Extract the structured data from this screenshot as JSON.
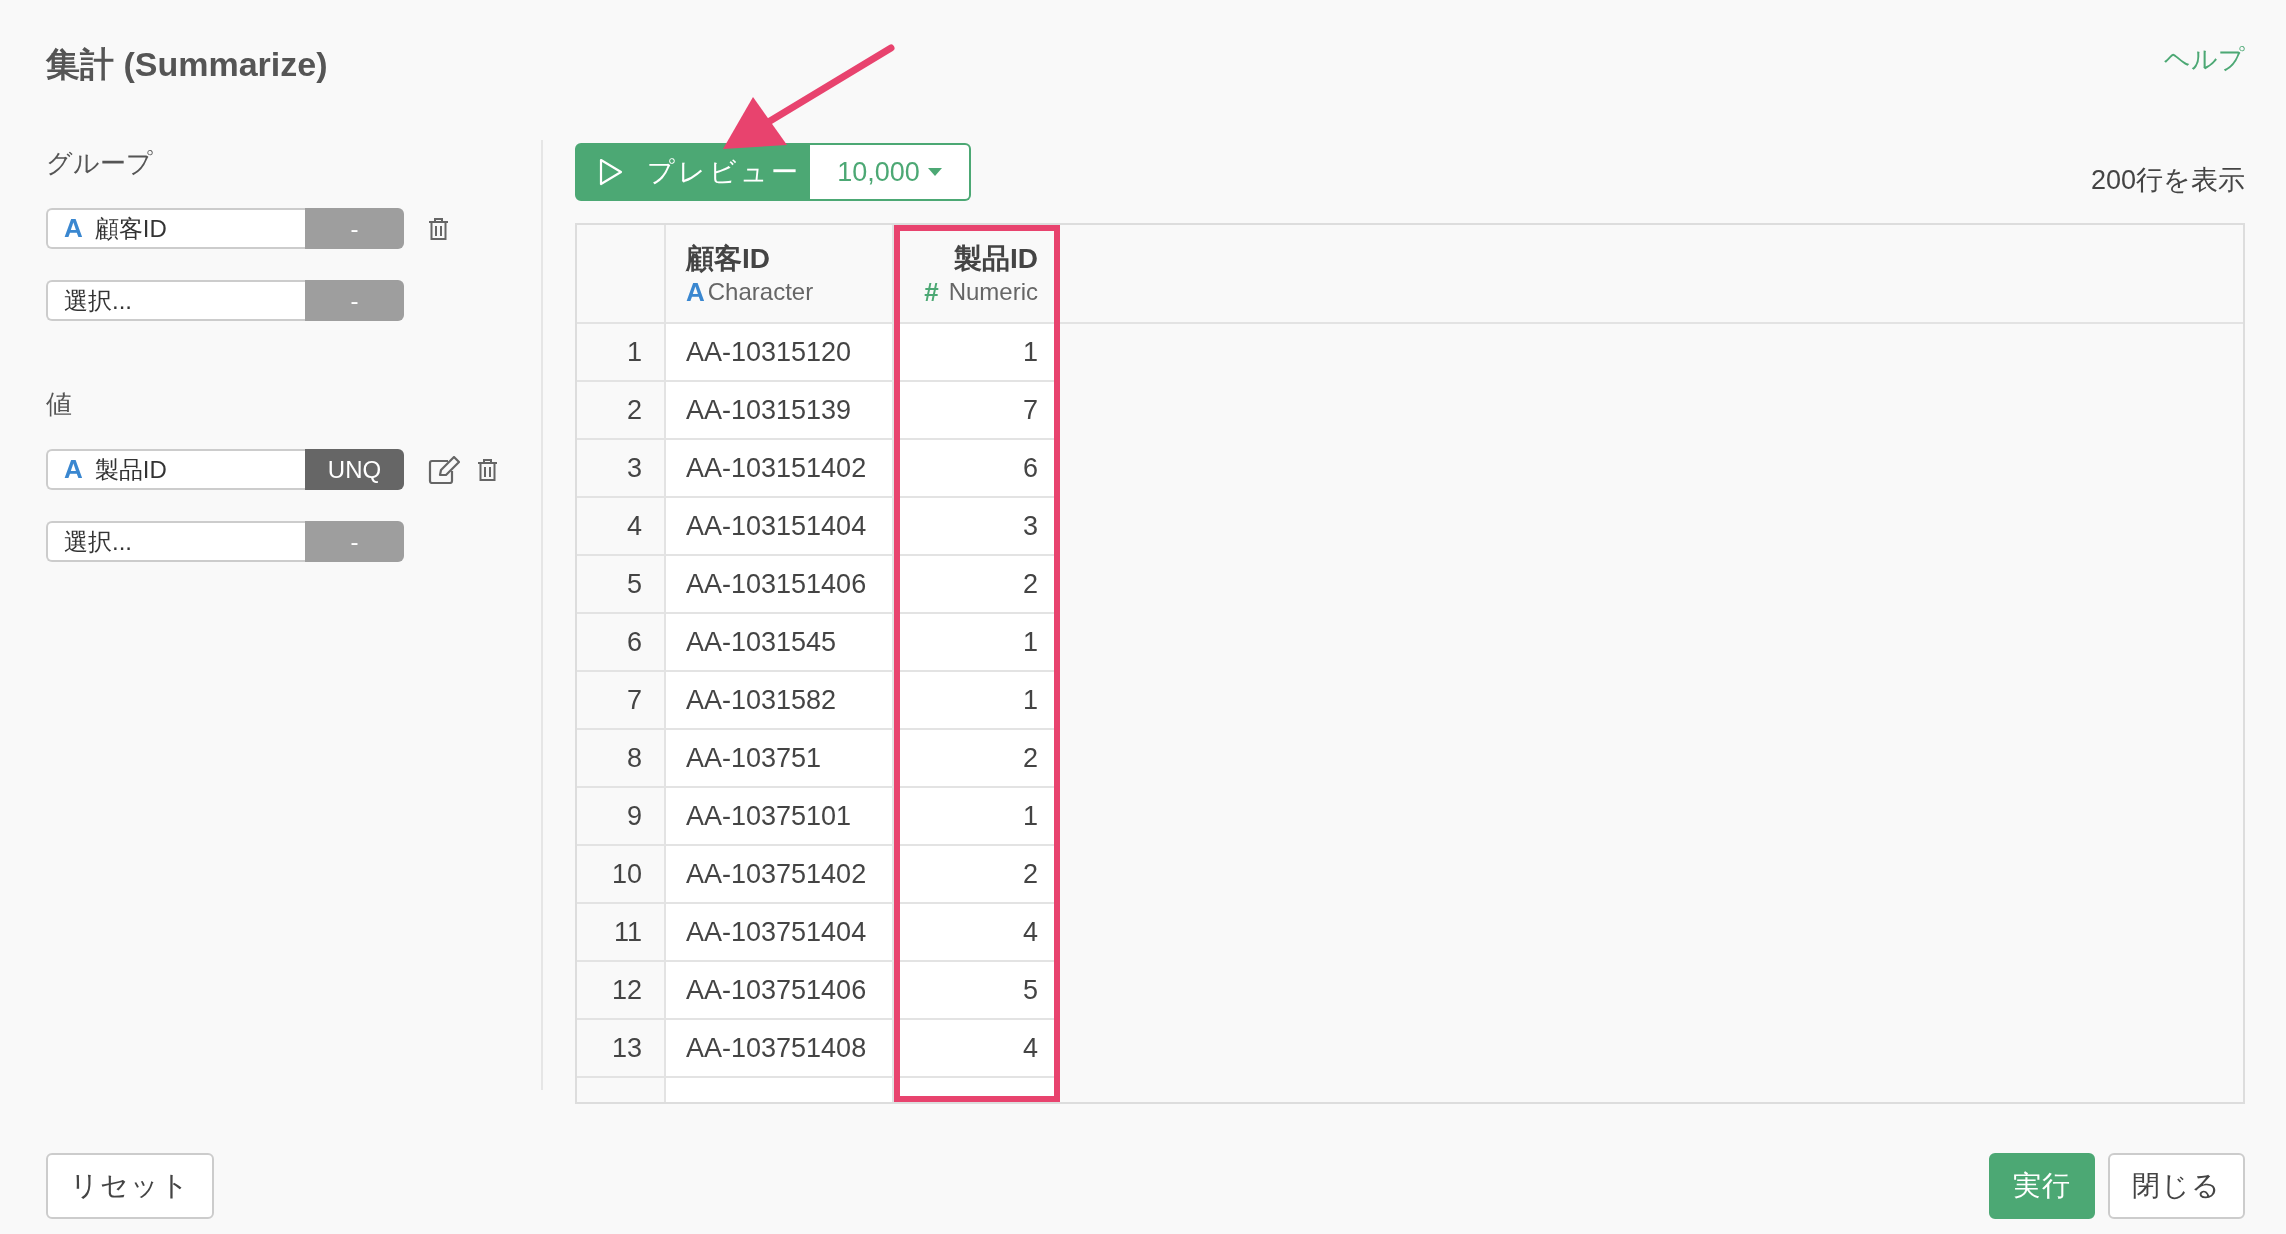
{
  "title": "集計 (Summarize)",
  "help_link": "ヘルプ",
  "sections": [
    {
      "label": "グループ",
      "rows": [
        {
          "kind": "character",
          "type_icon": "A",
          "value": "顧客ID",
          "function": "-",
          "function_set": false,
          "editable": false,
          "removable": true
        },
        {
          "placeholder": "選択...",
          "function": "-",
          "function_set": false,
          "editable": false,
          "removable": false
        }
      ]
    },
    {
      "label": "値",
      "rows": [
        {
          "kind": "character",
          "type_icon": "A",
          "value": "製品ID",
          "function": "UNQ",
          "function_set": true,
          "editable": true,
          "removable": true
        },
        {
          "placeholder": "選択...",
          "function": "-",
          "function_set": false,
          "editable": false,
          "removable": false
        }
      ]
    }
  ],
  "preview": {
    "label": "プレビュー",
    "arrow_pointer": true,
    "row_limit": "10,000"
  },
  "row_count": "200行を表示",
  "table": {
    "columns": [
      {
        "name": "顧客ID",
        "kind": "character",
        "type_icon": "A",
        "type": "Character",
        "highlighted": false
      },
      {
        "name": "製品ID",
        "kind": "numeric",
        "type_icon": "#",
        "type": "Numeric",
        "highlighted": true
      }
    ],
    "rows": [
      {
        "number": "1",
        "cells": [
          "AA-10315120",
          "1"
        ]
      },
      {
        "number": "2",
        "cells": [
          "AA-10315139",
          "7"
        ]
      },
      {
        "number": "3",
        "cells": [
          "AA-103151402",
          "6"
        ]
      },
      {
        "number": "4",
        "cells": [
          "AA-103151404",
          "3"
        ]
      },
      {
        "number": "5",
        "cells": [
          "AA-103151406",
          "2"
        ]
      },
      {
        "number": "6",
        "cells": [
          "AA-1031545",
          "1"
        ]
      },
      {
        "number": "7",
        "cells": [
          "AA-1031582",
          "1"
        ]
      },
      {
        "number": "8",
        "cells": [
          "AA-103751",
          "2"
        ]
      },
      {
        "number": "9",
        "cells": [
          "AA-10375101",
          "1"
        ]
      },
      {
        "number": "10",
        "cells": [
          "AA-103751402",
          "2"
        ]
      },
      {
        "number": "11",
        "cells": [
          "AA-103751404",
          "4"
        ]
      },
      {
        "number": "12",
        "cells": [
          "AA-103751406",
          "5"
        ]
      },
      {
        "number": "13",
        "cells": [
          "AA-103751408",
          "4"
        ]
      }
    ]
  },
  "footer": {
    "left": [
      {
        "label": "リセット",
        "kind": "default"
      }
    ],
    "right": [
      {
        "label": "実行",
        "kind": "primary"
      },
      {
        "label": "閉じる",
        "kind": "default"
      }
    ]
  }
}
